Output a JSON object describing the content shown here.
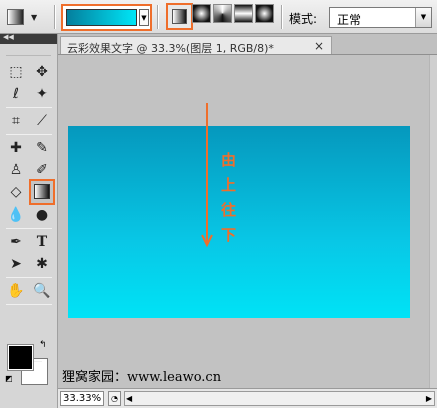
{
  "options_bar": {
    "tool_preset_icon": "gradient-tool-icon",
    "gradient_colors": [
      "#047f9d",
      "#00e6f7"
    ],
    "gradient_types": [
      "linear",
      "radial",
      "angle",
      "reflected",
      "diamond"
    ],
    "selected_gradient_type": "linear",
    "mode_label": "模式:",
    "mode_value": "正常"
  },
  "toolbox": {
    "collapse_icon": "double-chevron-icon",
    "tools": [
      "rect-marquee-icon",
      "move-icon",
      "lasso-icon",
      "magic-wand-icon",
      "crop-icon",
      "eyedropper-icon",
      "spot-healing-icon",
      "brush-icon",
      "clone-stamp-icon",
      "history-brush-icon",
      "eraser-icon",
      "gradient-icon",
      "blur-icon",
      "dodge-icon",
      "pen-icon",
      "type-icon",
      "path-select-icon",
      "custom-shape-icon",
      "hand-icon",
      "zoom-icon"
    ],
    "selected_tool": "gradient-icon",
    "foreground_color": "#000000",
    "background_color": "#ffffff"
  },
  "document": {
    "tab_title": "云彩效果文字 @ 33.3%(图层 1, RGB/8)*",
    "close_glyph": "×",
    "layer_gradient": [
      "#0598bd",
      "#00e3f6"
    ],
    "annotation_chars": [
      "由",
      "上",
      "往",
      "下"
    ],
    "annotation_color": "#ef6e2b",
    "watermark": "狸窝家园：www.leawo.cn",
    "zoom": "33.33%"
  },
  "accent_color": "#ef6e2b"
}
